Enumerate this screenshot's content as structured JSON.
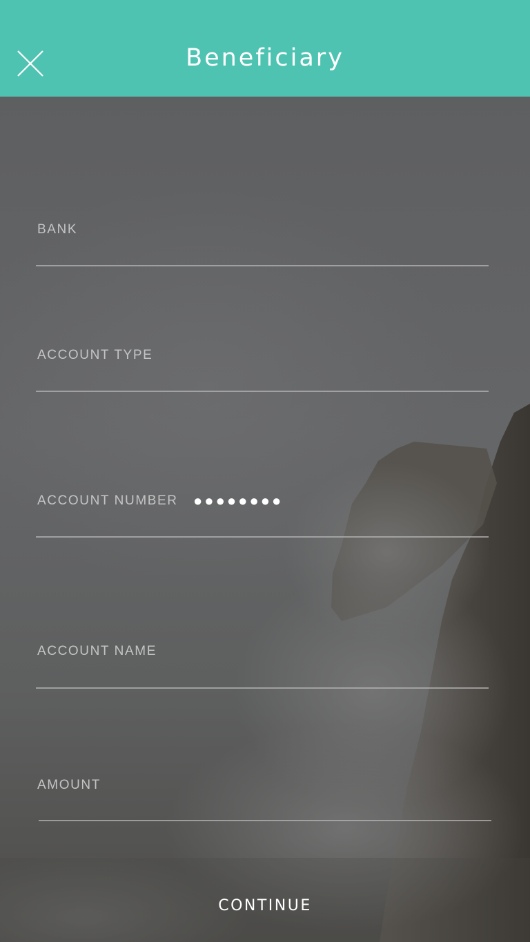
{
  "header": {
    "title": "Beneficiary",
    "close_icon": "close-icon",
    "background_color": "#4fc3b1"
  },
  "form": {
    "fields": [
      {
        "label": "BANK",
        "value": ""
      },
      {
        "label": "ACCOUNT TYPE",
        "value": ""
      },
      {
        "label": "ACCOUNT NUMBER",
        "value": "●●●●●●●●"
      },
      {
        "label": "ACCOUNT NAME",
        "value": ""
      },
      {
        "label": "AMOUNT",
        "value": ""
      }
    ]
  },
  "footer": {
    "continue_label": "CONTINUE"
  }
}
